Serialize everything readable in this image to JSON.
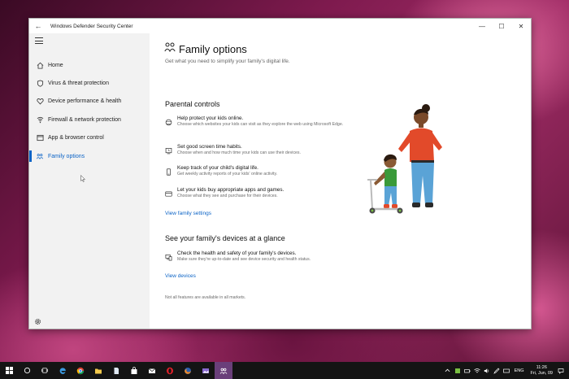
{
  "window": {
    "title": "Windows Defender Security Center"
  },
  "sidebar": {
    "items": [
      {
        "label": "Home",
        "icon": "home-icon",
        "active": false
      },
      {
        "label": "Virus & threat protection",
        "icon": "shield-icon",
        "active": false
      },
      {
        "label": "Device performance & health",
        "icon": "heart-icon",
        "active": false
      },
      {
        "label": "Firewall & network protection",
        "icon": "network-icon",
        "active": false
      },
      {
        "label": "App & browser control",
        "icon": "app-window-icon",
        "active": false
      },
      {
        "label": "Family options",
        "icon": "family-icon",
        "active": true
      }
    ]
  },
  "main": {
    "title": "Family options",
    "subtitle": "Get what you need to simplify your family's digital life.",
    "parental": {
      "heading": "Parental controls",
      "items": [
        {
          "icon": "globe-icon",
          "title": "Help protect your kids online.",
          "desc": "Choose which websites your kids can visit as they explore the web using Microsoft Edge."
        },
        {
          "icon": "clock-icon",
          "title": "Set good screen time habits.",
          "desc": "Choose when and how much time your kids can use their devices."
        },
        {
          "icon": "phone-icon",
          "title": "Keep track of your child's digital life.",
          "desc": "Get weekly activity reports of your kids' online activity."
        },
        {
          "icon": "card-icon",
          "title": "Let your kids buy appropriate apps and games.",
          "desc": "Choose what they see and purchase for their devices."
        }
      ],
      "link": "View family settings"
    },
    "devices": {
      "heading": "See your family's devices at a glance",
      "item_title": "Check the health and safety of your family's devices.",
      "item_desc": "Make sure they're up-to-date and see device security and health status.",
      "link": "View devices"
    },
    "note": "Not all features are available in all markets."
  },
  "taskbar": {
    "lang": "ENG",
    "time": "11:26",
    "date": "Fri, Jun, 09"
  },
  "colors": {
    "accent": "#0b63c6",
    "sidebar_bg": "#f2f2f2",
    "taskbar_bg": "#141414"
  }
}
